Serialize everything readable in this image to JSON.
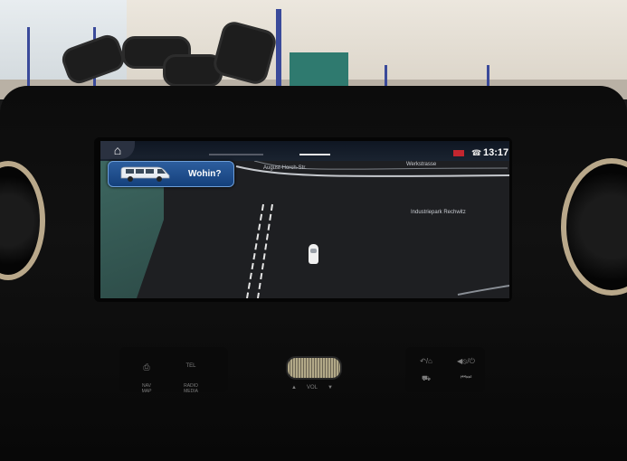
{
  "environment": {
    "description_hidden": ""
  },
  "screen": {
    "home_icon": "home-icon",
    "clock": "13:17",
    "destination_button": {
      "label": "Wohin?",
      "icon": "van-icon"
    },
    "streets": {
      "street_1": "August-Horch-Str.",
      "street_2": "Werkstrasse",
      "area": "Industriepark Rechwitz"
    },
    "status_icons": [
      "red-status-badge",
      "phone-signal-icon"
    ],
    "colors": {
      "accent": "#1f5aa8",
      "map_background": "#1e1f22",
      "map_green": "#3f6a63",
      "status_red": "#c3262f"
    }
  },
  "hardware_buttons": {
    "left": [
      {
        "name": "camera-icon",
        "label": ""
      },
      {
        "name": "tel",
        "label": "TEL"
      },
      {
        "name": "nav-map",
        "label": "NAV\nMAP"
      },
      {
        "name": "radio-media",
        "label": "RADIO\nMEDIA"
      }
    ],
    "center": {
      "vol_label": "VOL",
      "vol_up": "▲",
      "vol_down": "▼"
    },
    "right": [
      {
        "name": "back-home-icon",
        "label": "↶/⌂"
      },
      {
        "name": "mute-power-icon",
        "label": "◀⦸/⏻"
      },
      {
        "name": "car-settings-icon",
        "label": "⛟"
      },
      {
        "name": "skip-icon",
        "label": "⏮⏭"
      }
    ]
  }
}
